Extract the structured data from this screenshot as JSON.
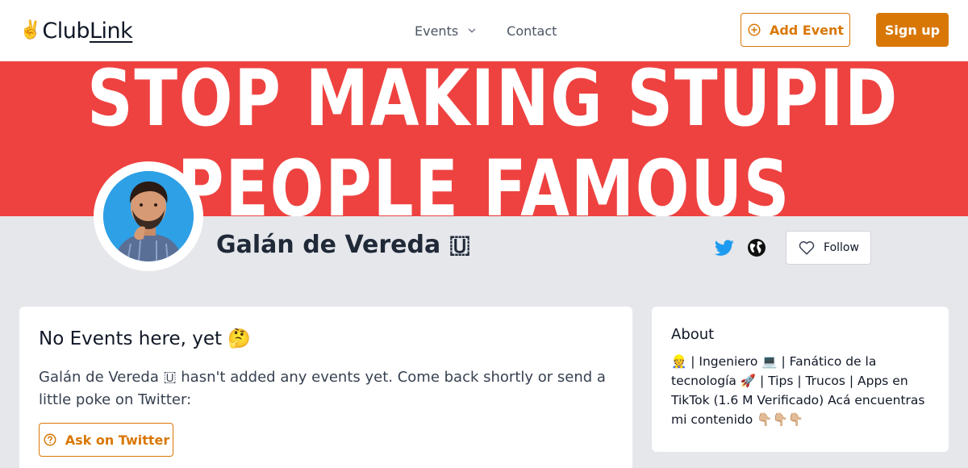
{
  "header": {
    "logo": {
      "hand": "✌️",
      "text_main": "Club",
      "text_link": "Link"
    },
    "nav": [
      {
        "label": "Events",
        "has_dropdown": true
      },
      {
        "label": "Contact",
        "has_dropdown": false
      }
    ],
    "add_event_label": "Add Event",
    "signup_label": "Sign up"
  },
  "banner": {
    "line1": "STOP MAKING STUPID",
    "line2": "PEOPLE FAMOUS",
    "background_color": "#ee4240"
  },
  "profile": {
    "name": "Galán de Vereda 🇺",
    "follow_label": "Follow",
    "social_icons": [
      "twitter-icon",
      "globe-icon"
    ]
  },
  "events_card": {
    "title": "No Events here, yet 🤔",
    "message": "Galán de Vereda 🇺 hasn't added any events yet. Come back shortly or send a little poke on Twitter:",
    "ask_label": "Ask on Twitter"
  },
  "about_card": {
    "title": "About",
    "text": "👷 | Ingeniero 💻 | Fanático de la tecnología 🚀 | Tips | Trucos | Apps en TikTok (1.6 M Verificado) Acá encuentras mi contenido 👇🏼👇🏼👇🏼"
  },
  "colors": {
    "accent": "#d97706",
    "page_bg": "#e5e7eb",
    "twitter": "#1d9bf0"
  }
}
